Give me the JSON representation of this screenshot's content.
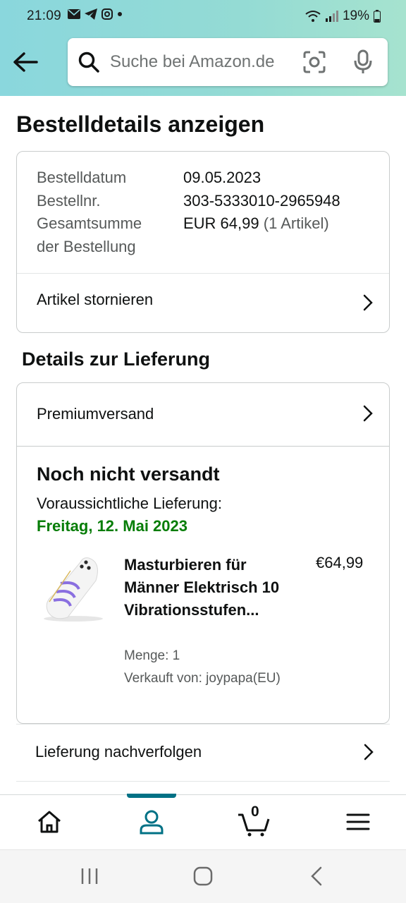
{
  "status_bar": {
    "time": "21:09",
    "battery": "19%"
  },
  "search": {
    "placeholder": "Suche bei Amazon.de"
  },
  "page_title": "Bestelldetails anzeigen",
  "order": {
    "date_label": "Bestelldatum",
    "date_value": "09.05.2023",
    "number_label": "Bestellnr.",
    "number_value": "303-5333010-2965948",
    "total_label_line1": "Gesamtsumme",
    "total_label_line2": "der Bestellung",
    "total_value": "EUR 64,99",
    "total_items": "(1 Artikel)",
    "cancel_link": "Artikel stornieren"
  },
  "delivery": {
    "section_title": "Details zur Lieferung",
    "shipping_method": "Premiumversand",
    "status": "Noch nicht versandt",
    "eta_label": "Voraussichtliche Lieferung:",
    "eta_date": "Freitag, 12. Mai 2023",
    "eta_color": "#067d07",
    "product": {
      "title": "Masturbieren für Männer Elektrisch 10 Vibrationsstufen...",
      "price": "€64,99",
      "quantity": "Menge: 1",
      "seller": "Verkauft von: joypapa(EU)"
    },
    "track_link": "Lieferung nachverfolgen"
  },
  "bottom_nav": {
    "active": "account",
    "cart_count": "0",
    "accent_color": "#007185"
  }
}
